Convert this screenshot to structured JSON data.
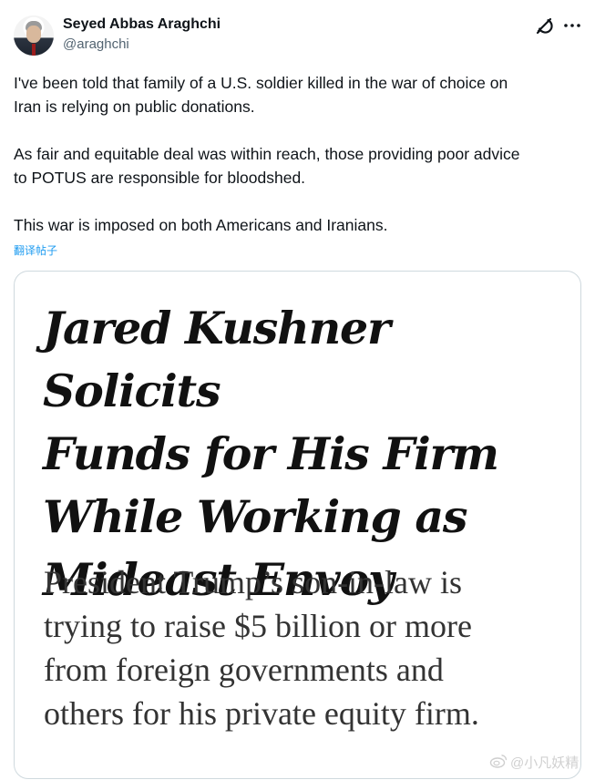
{
  "author": {
    "name": "Seyed Abbas Araghchi",
    "handle": "@araghchi"
  },
  "icons": {
    "grok": "grok-icon",
    "more": "more-icon",
    "avatar": "avatar"
  },
  "tweet": {
    "text": "I've been told that family of a U.S. soldier killed in the war of choice on\nIran is relying on public donations.\n\nAs fair and equitable deal was within reach, those providing poor advice\nto POTUS are responsible for bloodshed.\n\nThis war is imposed on both Americans and Iranians.",
    "translate_label": "翻译帖子"
  },
  "media": {
    "headline": "Jared Kushner Solicits\nFunds for His Firm\nWhile Working as\nMideast Envoy",
    "subheadline": "President Trump’s son-in-law is\ntrying to raise $5 billion or more\nfrom foreign governments and\nothers for his private equity firm."
  },
  "watermark": {
    "text": "@小凡妖精"
  },
  "colors": {
    "link": "#1d9bf0",
    "secondary_text": "#536471",
    "border": "#cfd9de"
  }
}
